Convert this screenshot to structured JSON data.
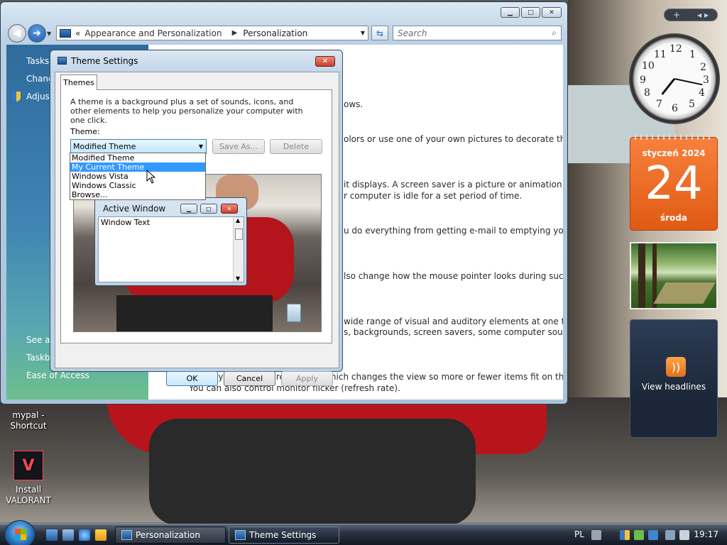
{
  "explorer": {
    "breadcrumb": [
      "Appearance and Personalization",
      "Personalization"
    ],
    "breadcrumb_prefix": "«",
    "search_placeholder": "Search",
    "sidebar": {
      "tasks": "Tasks",
      "change": "Chang",
      "adjust": "Adjust",
      "see_also": "See a",
      "taskbar": "Taskb",
      "ease": "Ease of Access"
    },
    "main_lines": [
      "ows.",
      "olors or use one of your own pictures to decorate the",
      "it displays. A screen saver is a picture or animation that",
      "r computer is idle for a set period of time.",
      "u do everything from getting e-mail to emptying your",
      "lso change how the mouse pointer looks during such",
      "wide range of visual and auditory elements at one time",
      "s, backgrounds, screen savers, some computer sounds,",
      "Adjust your monitor resolution, which changes the view so more or fewer items fit on the screen.",
      "You can also control monitor flicker (refresh rate)."
    ]
  },
  "dialog": {
    "title": "Theme Settings",
    "tab": "Themes",
    "description": "A theme is a background plus a set of sounds, icons, and other elements to help you personalize your computer with one click.",
    "theme_label": "Theme:",
    "theme_value": "Modified Theme",
    "save_as": "Save As...",
    "delete": "Delete",
    "dropdown_options": [
      "Modified Theme",
      "My Current Theme",
      "Windows Vista",
      "Windows Classic",
      "Browse..."
    ],
    "dropdown_highlighted": "My Current Theme",
    "preview": {
      "active_window_title": "Active Window",
      "window_text": "Window Text"
    },
    "ok": "OK",
    "cancel": "Cancel",
    "apply": "Apply"
  },
  "gadgets": {
    "clock": {
      "numbers": [
        "12",
        "1",
        "2",
        "3",
        "4",
        "5",
        "6",
        "7",
        "8",
        "9",
        "10",
        "11"
      ],
      "hour": 7,
      "minute": 17
    },
    "calendar": {
      "month": "styczeń 2024",
      "day": "24",
      "weekday": "środa"
    },
    "feed": {
      "label": "View headlines"
    },
    "bar_add": "+",
    "bar_nav": "◂ ▸"
  },
  "desktop_icons": [
    {
      "label": "mypal - Shortcut"
    },
    {
      "label": "Install VALORANT"
    }
  ],
  "taskbar": {
    "buttons": [
      {
        "label": "Personalization"
      },
      {
        "label": "Theme Settings"
      }
    ],
    "language": "PL",
    "time": "19:17"
  }
}
